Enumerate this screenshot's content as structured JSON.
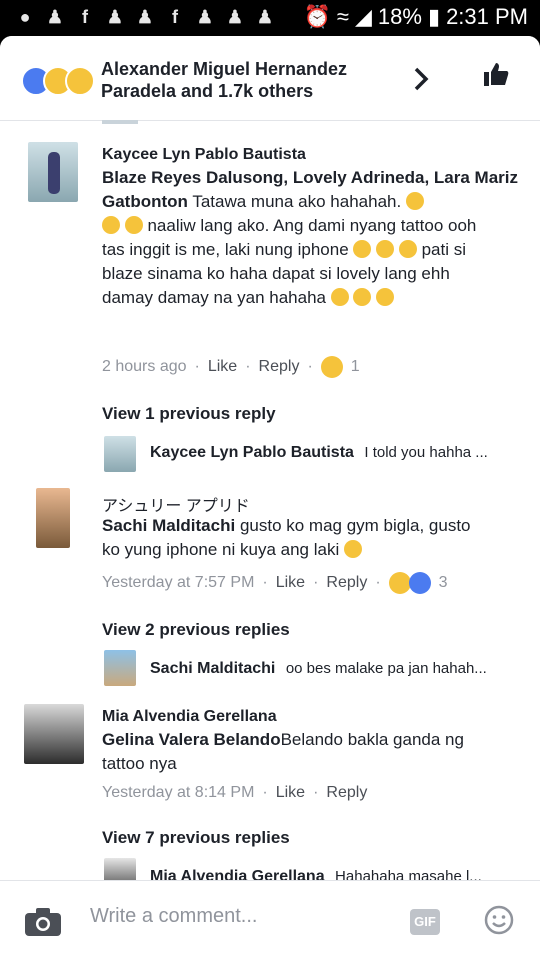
{
  "status_bar": {
    "battery": "18%",
    "time": "2:31 PM"
  },
  "header": {
    "title": "Alexander Miguel Hernandez Paradela and 1.7k others",
    "reactions": [
      "like",
      "haha",
      "wow"
    ]
  },
  "comments": [
    {
      "name": "Kaycee Lyn Pablo Bautista",
      "tags": "Blaze Reyes Dalusong, Lovely Adrineda, Lara Mariz Gatbonton",
      "text1": "Tatawa muna ako hahahah.",
      "text2": "naaliw lang ako. Ang dami nyang tattoo ooh",
      "text3": "tas inggit is me, laki nung iphone",
      "text4": "pati si",
      "text5": "blaze sinama ko haha dapat si lovely lang ehh",
      "text6": "damay damay na yan hahaha",
      "time": "2 hours ago",
      "like": "Like",
      "reply": "Reply",
      "reaction_count": "1",
      "view_prev": "View 1 previous reply",
      "reply_name": "Kaycee Lyn Pablo Bautista",
      "reply_text": "I told you hahha ..."
    },
    {
      "name": "アシュリー アプリド",
      "tags": "Sachi Malditachi",
      "text1": "gusto ko mag gym bigla, gusto",
      "text2": "ko yung iphone ni kuya ang laki",
      "time": "Yesterday at 7:57 PM",
      "like": "Like",
      "reply": "Reply",
      "reaction_count": "3",
      "view_prev": "View 2 previous replies",
      "reply_name": "Sachi Malditachi",
      "reply_text": "oo bes malake pa jan hahah..."
    },
    {
      "name": "Mia Alvendia Gerellana",
      "tags": "Gelina Valera Belando",
      "text1": "Belando bakla ganda ng",
      "text2": "tattoo nya",
      "time": "Yesterday at 8:14 PM",
      "like": "Like",
      "reply": "Reply",
      "view_prev": "View 7 previous replies",
      "reply_name": "Mia Alvendia Gerellana",
      "reply_text": "Hahahaha masahe l..."
    }
  ],
  "composer": {
    "placeholder": "Write a comment...",
    "gif": "GIF"
  }
}
